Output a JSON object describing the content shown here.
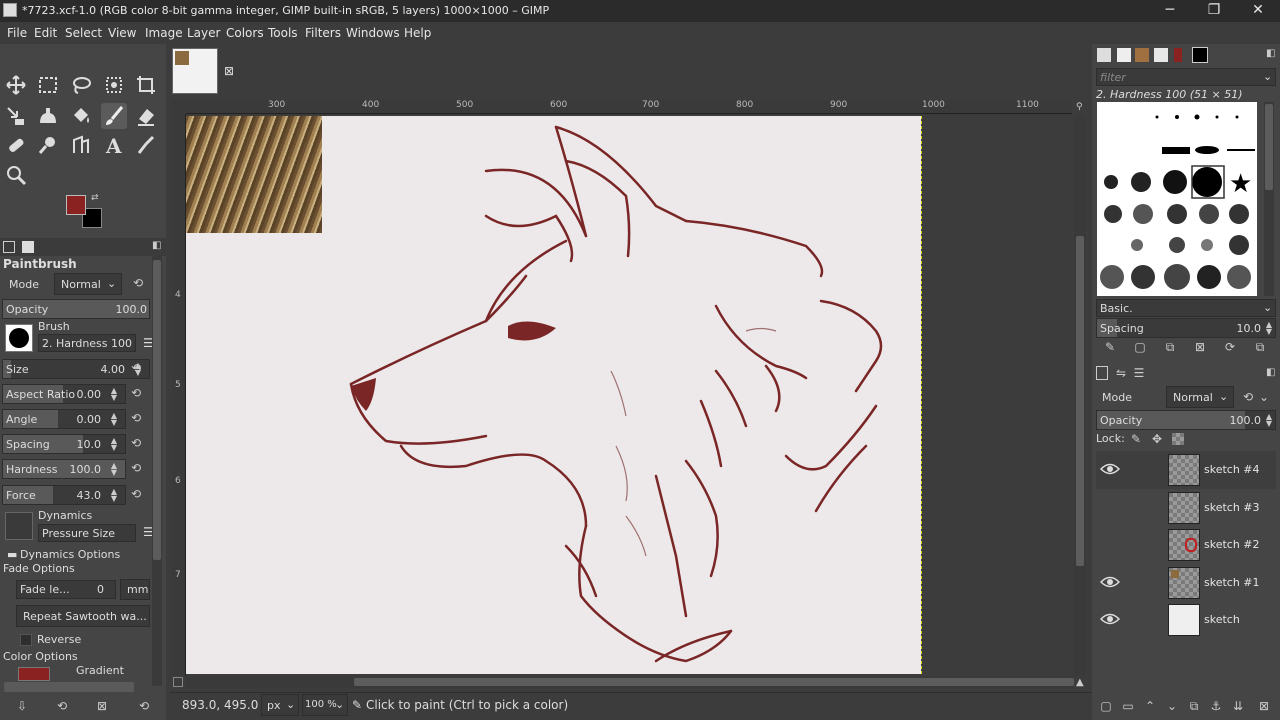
{
  "window": {
    "title": "*7723.xcf-1.0 (RGB color 8-bit gamma integer, GIMP built-in sRGB, 5 layers) 1000×1000 – GIMP",
    "minimize": "─",
    "restore": "❐",
    "close": "✕"
  },
  "menu": [
    "File",
    "Edit",
    "Select",
    "View",
    "Image",
    "Layer",
    "Colors",
    "Tools",
    "Filters",
    "Windows",
    "Help"
  ],
  "colors": {
    "foreground": "#8b2222",
    "background": "#000000",
    "stroke": "#7a2626",
    "accent_ring": "#ffd000"
  },
  "tool_options": {
    "tool_name": "Paintbrush",
    "mode_label": "Mode",
    "mode_value": "Normal",
    "opacity_label": "Opacity",
    "opacity_value": "100.0",
    "brush_label": "Brush",
    "brush_name": "2. Hardness 100",
    "size_label": "Size",
    "size_value": "4.00",
    "aspect_label": "Aspect Ratio",
    "aspect_value": "0.00",
    "angle_label": "Angle",
    "angle_value": "0.00",
    "spacing_label": "Spacing",
    "spacing_value": "10.0",
    "hardness_label": "Hardness",
    "hardness_value": "100.0",
    "force_label": "Force",
    "force_value": "43.0",
    "dynamics_label": "Dynamics",
    "dynamics_value": "Pressure Size",
    "dynamics_options": "Dynamics Options",
    "fade_options": "Fade Options",
    "fade_length_label": "Fade le...",
    "fade_length_value": "0",
    "fade_unit": "mm",
    "repeat_value": "Repeat Sawtooth wa...",
    "reverse_label": "Reverse",
    "color_options": "Color Options",
    "gradient_label": "Gradient"
  },
  "rulers": {
    "h": [
      "300",
      "400",
      "500",
      "600",
      "700",
      "800",
      "900",
      "1000",
      "1100"
    ],
    "v": [
      "4",
      "5",
      "6",
      "7"
    ]
  },
  "status": {
    "coords": "893.0, 495.0",
    "unit": "px",
    "zoom": "100 %",
    "message": "Click to paint (Ctrl to pick a color)"
  },
  "brushes": {
    "filter_placeholder": "filter",
    "current": "2. Hardness 100 (51 × 51)",
    "tag": "Basic.",
    "spacing_label": "Spacing",
    "spacing_value": "10.0"
  },
  "layers": {
    "mode_label": "Mode",
    "mode_value": "Normal",
    "opacity_label": "Opacity",
    "opacity_value": "100.0",
    "lock_label": "Lock:",
    "items": [
      {
        "name": "sketch #4",
        "visible": true
      },
      {
        "name": "sketch #3",
        "visible": false
      },
      {
        "name": "sketch #2",
        "visible": false
      },
      {
        "name": "sketch #1",
        "visible": true
      },
      {
        "name": "sketch",
        "visible": true
      }
    ]
  }
}
